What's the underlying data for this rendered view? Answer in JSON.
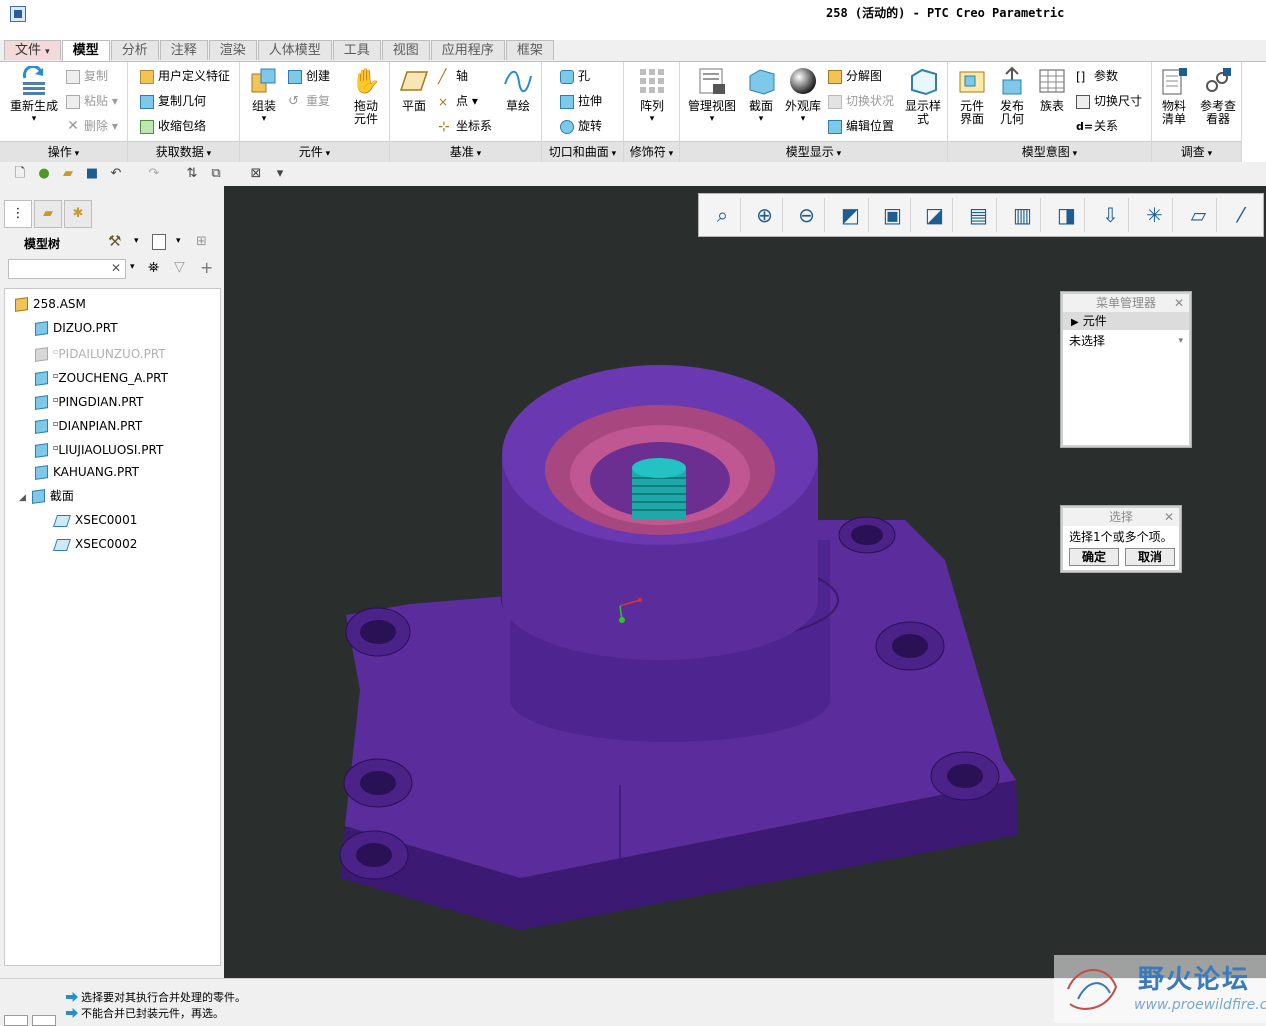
{
  "window": {
    "title": "258 (活动的) - PTC Creo Parametric"
  },
  "tabs": [
    {
      "label": "文件",
      "dropdown": "▾"
    },
    {
      "label": "模型"
    },
    {
      "label": "分析"
    },
    {
      "label": "注释"
    },
    {
      "label": "渲染"
    },
    {
      "label": "人体模型"
    },
    {
      "label": "工具"
    },
    {
      "label": "视图"
    },
    {
      "label": "应用程序"
    },
    {
      "label": "框架"
    }
  ],
  "ribbon": {
    "operations": {
      "group": "操作",
      "regenerate": "重新生成",
      "copy": "复制",
      "paste": "粘贴",
      "delete": "删除"
    },
    "get_data": {
      "group": "获取数据",
      "udf": "用户定义特征",
      "copy_geom": "复制几何",
      "shrinkwrap": "收缩包络"
    },
    "component": {
      "group": "元件",
      "assemble": "组装",
      "create": "创建",
      "repeat": "重复",
      "drag_line1": "拖动",
      "drag_line2": "元件"
    },
    "datum": {
      "group": "基准",
      "plane": "平面",
      "axis": "轴",
      "point": "点",
      "csys": "坐标系",
      "sketch": "草绘"
    },
    "cut": {
      "group": "切口和曲面",
      "hole": "孔",
      "extrude": "拉伸",
      "revolve": "旋转"
    },
    "modifiers": {
      "group": "修饰符",
      "pattern": "阵列"
    },
    "model_display": {
      "group": "模型显示",
      "manage_views": "管理视图",
      "section": "截面",
      "appearance": "外观库",
      "explode": "分解图",
      "toggle_status": "切换状况",
      "edit_position": "编辑位置",
      "display_style_line1": "显示样",
      "display_style_line2": "式"
    },
    "model_intent": {
      "group": "模型意图",
      "comp_iface_line1": "元件",
      "comp_iface_line2": "界面",
      "publish_line1": "发布",
      "publish_line2": "几何",
      "family_table": "族表",
      "params": "参数",
      "toggle_dims": "切换尺寸",
      "relations": "关系"
    },
    "investigate": {
      "group": "调查",
      "bom_line1": "物料",
      "bom_line2": "清单",
      "ref_line1": "参考查",
      "ref_line2": "看器"
    }
  },
  "model_tree": {
    "title": "模型树",
    "search_placeholder": "",
    "items": [
      {
        "label": "258.ASM",
        "level": 0,
        "type": "asm"
      },
      {
        "label": "DIZUO.PRT",
        "level": 1,
        "type": "prt"
      },
      {
        "label": "PIDAILUNZUO.PRT",
        "level": 1,
        "type": "prt-suppressed"
      },
      {
        "label": "ZOUCHENG_A.PRT",
        "level": 1,
        "type": "prt"
      },
      {
        "label": "PINGDIAN.PRT",
        "level": 1,
        "type": "prt"
      },
      {
        "label": "DIANPIAN.PRT",
        "level": 1,
        "type": "prt"
      },
      {
        "label": "LIUJIAOLUOSI.PRT",
        "level": 1,
        "type": "prt"
      },
      {
        "label": "KAHUANG.PRT",
        "level": 1,
        "type": "prt"
      },
      {
        "label": "截面",
        "level": 1,
        "type": "folder"
      },
      {
        "label": "XSEC0001",
        "level": 2,
        "type": "section"
      },
      {
        "label": "XSEC0002",
        "level": 2,
        "type": "section"
      }
    ]
  },
  "menu_manager": {
    "title": "菜单管理器",
    "item": "元件",
    "selection": "未选择"
  },
  "select_dialog": {
    "title": "选择",
    "prompt": "选择1个或多个项。",
    "ok": "确定",
    "cancel": "取消"
  },
  "status": {
    "line1": "选择要对其执行合并处理的零件。",
    "line2": "不能合并已封装元件，再选。"
  },
  "watermark": {
    "name": "野火论坛",
    "url": "www.proewildfire.cn"
  },
  "colors": {
    "model": "#5b2d9c",
    "viewport_bg": "#2a2e2d",
    "accent": "#1d5d90"
  }
}
